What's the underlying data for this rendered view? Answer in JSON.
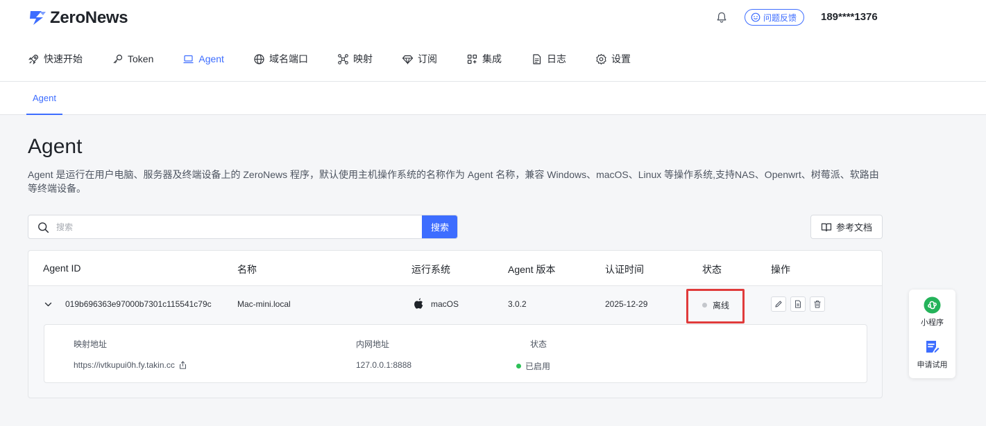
{
  "header": {
    "logo_text": "ZeroNews",
    "feedback_label": "问题反馈",
    "user_label": "189****1376"
  },
  "nav": [
    {
      "label": "快速开始",
      "icon": "rocket-icon",
      "active": false
    },
    {
      "label": "Token",
      "icon": "key-icon",
      "active": false
    },
    {
      "label": "Agent",
      "icon": "laptop-icon",
      "active": true
    },
    {
      "label": "域名端口",
      "icon": "globe-icon",
      "active": false
    },
    {
      "label": "映射",
      "icon": "network-icon",
      "active": false
    },
    {
      "label": "订阅",
      "icon": "diamond-icon",
      "active": false
    },
    {
      "label": "集成",
      "icon": "grid-icon",
      "active": false
    },
    {
      "label": "日志",
      "icon": "document-icon",
      "active": false
    },
    {
      "label": "设置",
      "icon": "gear-icon",
      "active": false
    }
  ],
  "subtab": {
    "label": "Agent"
  },
  "page": {
    "title": "Agent",
    "description": "Agent 是运行在用户电脑、服务器及终端设备上的 ZeroNews 程序，默认使用主机操作系统的名称作为 Agent 名称，兼容 Windows、macOS、Linux 等操作系统,支持NAS、Openwrt、树莓派、软路由等终端设备。"
  },
  "search": {
    "placeholder": "搜索",
    "value": "",
    "button_label": "搜索"
  },
  "docs_button_label": "参考文档",
  "table": {
    "columns": [
      "Agent ID",
      "名称",
      "运行系统",
      "Agent 版本",
      "认证时间",
      "状态",
      "操作"
    ],
    "rows": [
      {
        "agent_id": "019b696363e97000b7301c115541c79c",
        "name": "Mac-mini.local",
        "os": "macOS",
        "version": "3.0.2",
        "auth_time": "2025-12-29",
        "status": "离线",
        "detail": {
          "headers": [
            "映射地址",
            "内网地址",
            "状态"
          ],
          "mapping_address": "https://ivtkupui0h.fy.takin.cc",
          "internal_address": "127.0.0.1:8888",
          "status": "已启用"
        }
      }
    ]
  },
  "float_widget": {
    "items": [
      {
        "label": "小程序",
        "icon": "mini-program-icon"
      },
      {
        "label": "申请试用",
        "icon": "apply-trial-icon"
      }
    ]
  },
  "colors": {
    "accent": "#3d6dff",
    "offline_dot": "#c4c7cc",
    "enabled_dot": "#2cc057",
    "highlight": "#e03b3b",
    "mini_program_green": "#24b35a"
  }
}
